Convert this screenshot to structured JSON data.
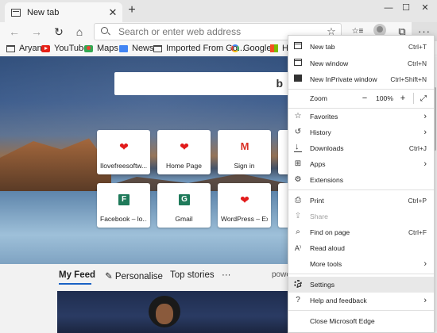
{
  "tab": {
    "title": "New tab",
    "close": "✕"
  },
  "window": {
    "minimize": "—",
    "maximize": "☐",
    "close": "✕"
  },
  "nav": {
    "back": "←",
    "forward": "→",
    "refresh": "↻",
    "home": "⌂"
  },
  "address": {
    "placeholder": "Search or enter web address",
    "favorite": "☆"
  },
  "toolbar": {
    "favorites": "☆≡",
    "collections": "⧉",
    "more": "···"
  },
  "bookmarks": [
    {
      "label": "Aryan",
      "icon": "folder-icon"
    },
    {
      "label": "YouTube",
      "icon": "youtube-icon"
    },
    {
      "label": "Maps",
      "icon": "maps-icon"
    },
    {
      "label": "News",
      "icon": "news-icon"
    },
    {
      "label": "Imported From Go...",
      "icon": "folder-icon"
    },
    {
      "label": "Google",
      "icon": "google-icon"
    },
    {
      "label": "H",
      "icon": "microsoft-icon"
    }
  ],
  "tiles": [
    {
      "label": "Ilovefreesoftw...",
      "icon": "heart-icon",
      "glyph": "❤"
    },
    {
      "label": "Home Page",
      "icon": "heart-icon",
      "glyph": "❤"
    },
    {
      "label": "Sign in",
      "icon": "gmail-icon",
      "glyph": "M"
    },
    {
      "label": "Facebook – lo...",
      "icon": "letter-f-icon",
      "glyph": "F"
    },
    {
      "label": "Gmail",
      "icon": "letter-g-icon",
      "glyph": "G"
    },
    {
      "label": "WordPress – Ex...",
      "icon": "heart-icon",
      "glyph": "❤"
    }
  ],
  "feed": {
    "my_feed": "My Feed",
    "personalise": "Personalise",
    "top_stories": "Top stories",
    "more": "···",
    "powered": "powe"
  },
  "menu": {
    "new_tab": {
      "label": "New tab",
      "shortcut": "Ctrl+T"
    },
    "new_window": {
      "label": "New window",
      "shortcut": "Ctrl+N"
    },
    "new_inprivate": {
      "label": "New InPrivate window",
      "shortcut": "Ctrl+Shift+N"
    },
    "zoom": {
      "label": "Zoom",
      "minus": "−",
      "value": "100%",
      "plus": "+",
      "fullscreen": "⤢"
    },
    "favorites": {
      "label": "Favorites"
    },
    "history": {
      "label": "History"
    },
    "downloads": {
      "label": "Downloads",
      "shortcut": "Ctrl+J"
    },
    "apps": {
      "label": "Apps"
    },
    "extensions": {
      "label": "Extensions"
    },
    "print": {
      "label": "Print",
      "shortcut": "Ctrl+P"
    },
    "share": {
      "label": "Share"
    },
    "find": {
      "label": "Find on page",
      "shortcut": "Ctrl+F"
    },
    "read_aloud": {
      "label": "Read aloud"
    },
    "more_tools": {
      "label": "More tools"
    },
    "settings": {
      "label": "Settings"
    },
    "help": {
      "label": "Help and feedback"
    },
    "close_edge": {
      "label": "Close Microsoft Edge"
    },
    "chevron": "›"
  }
}
